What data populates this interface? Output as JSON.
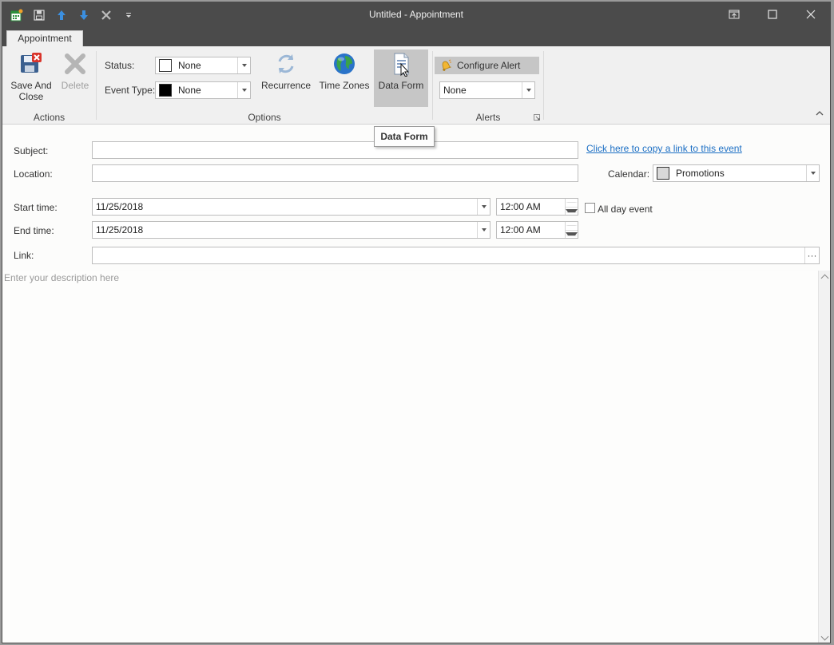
{
  "window": {
    "title": "Untitled - Appointment"
  },
  "quick_access": [
    {
      "name": "app-icon"
    },
    {
      "name": "save-icon"
    },
    {
      "name": "arrow-up-icon"
    },
    {
      "name": "arrow-down-icon"
    },
    {
      "name": "close-x-icon"
    },
    {
      "name": "customize-qat-icon"
    }
  ],
  "tabs": [
    {
      "label": "Appointment"
    }
  ],
  "ribbon": {
    "actions": {
      "group_label": "Actions",
      "save_and_close_line1": "Save And",
      "save_and_close_line2": "Close",
      "delete_label": "Delete"
    },
    "options": {
      "group_label": "Options",
      "status_label": "Status:",
      "status_value": "None",
      "status_color": "#ffffff",
      "event_type_label": "Event Type:",
      "event_type_value": "None",
      "event_type_color": "#000000",
      "recurrence_label": "Recurrence",
      "time_zones_label": "Time Zones",
      "data_form_label": "Data Form"
    },
    "alerts": {
      "group_label": "Alerts",
      "configure_alert_label": "Configure Alert",
      "alert_value": "None"
    }
  },
  "tooltip": {
    "text": "Data Form"
  },
  "form": {
    "subject_label": "Subject:",
    "subject_value": "",
    "copy_link_text": "Click here to copy a link to this event",
    "location_label": "Location:",
    "location_value": "",
    "calendar_label": "Calendar:",
    "calendar_value": "Promotions",
    "calendar_color": "#d9d9d9",
    "start_time_label": "Start time:",
    "start_date": "11/25/2018",
    "start_time": "12:00 AM",
    "all_day_label": "All day event",
    "all_day_checked": false,
    "end_time_label": "End time:",
    "end_date": "11/25/2018",
    "end_time": "12:00 AM",
    "link_label": "Link:",
    "link_value": "",
    "link_button": "···",
    "description_placeholder": "Enter your description here"
  },
  "colors": {
    "titlebar": "#4b4b4b",
    "ribbon": "#f0f0f0",
    "link": "#1c6fc4",
    "pressed": "#c6c6c6"
  }
}
